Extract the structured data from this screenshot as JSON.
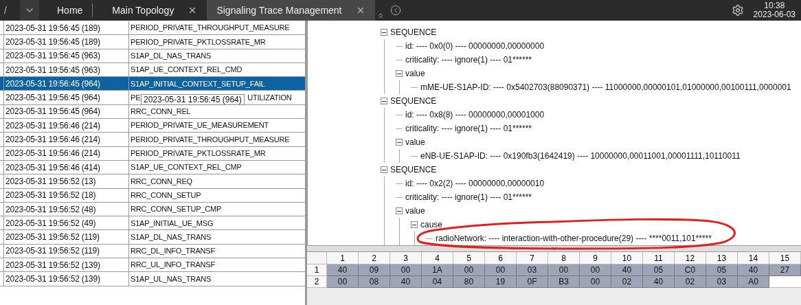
{
  "top_bar": {
    "path": "/",
    "tabs": [
      {
        "label": "Home",
        "selected": false,
        "closable": false
      },
      {
        "label": "Main Topology",
        "selected": false,
        "closable": true
      },
      {
        "label": "Signaling Trace Management",
        "selected": true,
        "closable": true
      }
    ],
    "time": "10:38",
    "date": "2023-06-03"
  },
  "trace_table": {
    "rows": [
      {
        "time": "2023-05-31 19:56:45 (189)",
        "event": "PERIOD_PRIVATE_THROUGHPUT_MEASURE",
        "selected": false
      },
      {
        "time": "2023-05-31 19:56:45 (189)",
        "event": "PERIOD_PRIVATE_PKTLOSSRATE_MR",
        "selected": false
      },
      {
        "time": "2023-05-31 19:56:45 (963)",
        "event": "S1AP_DL_NAS_TRANS",
        "selected": false
      },
      {
        "time": "2023-05-31 19:56:45 (963)",
        "event": "S1AP_UE_CONTEXT_REL_CMD",
        "selected": false
      },
      {
        "time": "2023-05-31 19:56:45 (964)",
        "event": "S1AP_INITIAL_CONTEXT_SETUP_FAIL",
        "selected": true
      },
      {
        "time": "2023-05-31 19:56:45 (964)",
        "event": "PE",
        "event_end": "UTILIZATION",
        "selected": false
      },
      {
        "time": "2023-05-31 19:56:45 (964)",
        "event": "RRC_CONN_REL",
        "selected": false
      },
      {
        "time": "2023-05-31 19:56:46 (214)",
        "event": "PERIOD_PRIVATE_UE_MEASUREMENT",
        "selected": false
      },
      {
        "time": "2023-05-31 19:56:46 (214)",
        "event": "PERIOD_PRIVATE_THROUGHPUT_MEASURE",
        "selected": false
      },
      {
        "time": "2023-05-31 19:56:46 (214)",
        "event": "PERIOD_PRIVATE_PKTLOSSRATE_MR",
        "selected": false
      },
      {
        "time": "2023-05-31 19:56:46 (414)",
        "event": "S1AP_UE_CONTEXT_REL_CMP",
        "selected": false
      },
      {
        "time": "2023-05-31 19:56:52 (13)",
        "event": "RRC_CONN_REQ",
        "selected": false
      },
      {
        "time": "2023-05-31 19:56:52 (18)",
        "event": "RRC_CONN_SETUP",
        "selected": false
      },
      {
        "time": "2023-05-31 19:56:52 (48)",
        "event": "RRC_CONN_SETUP_CMP",
        "selected": false
      },
      {
        "time": "2023-05-31 19:56:52 (49)",
        "event": "S1AP_INITIAL_UE_MSG",
        "selected": false
      },
      {
        "time": "2023-05-31 19:56:52 (119)",
        "event": "S1AP_DL_NAS_TRANS",
        "selected": false
      },
      {
        "time": "2023-05-31 19:56:52 (119)",
        "event": "RRC_DL_INFO_TRANSF",
        "selected": false
      },
      {
        "time": "2023-05-31 19:56:52 (139)",
        "event": "RRC_UL_INFO_TRANSF",
        "selected": false
      },
      {
        "time": "2023-05-31 19:56:52 (139)",
        "event": "S1AP_UL_NAS_TRANS",
        "selected": false
      }
    ],
    "tooltip": "2023-05-31 19:56:45 (964)"
  },
  "decode_tree": [
    {
      "label": "SEQUENCE",
      "expanded": true,
      "children": [
        {
          "label": "id: ---- 0x0(0) ---- 00000000,00000000"
        },
        {
          "label": "criticality: ---- ignore(1) ---- 01******"
        },
        {
          "label": "value",
          "expanded": true,
          "children": [
            {
              "label": "mME-UE-S1AP-ID: ---- 0x5402703(88090371) ---- 11000000,00000101,01000000,00100111,0000001"
            }
          ]
        }
      ]
    },
    {
      "label": "SEQUENCE",
      "expanded": true,
      "children": [
        {
          "label": "id: ---- 0x8(8) ---- 00000000,00001000"
        },
        {
          "label": "criticality: ---- ignore(1) ---- 01******"
        },
        {
          "label": "value",
          "expanded": true,
          "children": [
            {
              "label": "eNB-UE-S1AP-ID: ---- 0x190fb3(1642419) ---- 10000000,00011001,00001111,10110011"
            }
          ]
        }
      ]
    },
    {
      "label": "SEQUENCE",
      "expanded": true,
      "children": [
        {
          "label": "id: ---- 0x2(2) ---- 00000000,00000010"
        },
        {
          "label": "criticality: ---- ignore(1) ---- 01******"
        },
        {
          "label": "value",
          "expanded": true,
          "children": [
            {
              "label": "cause",
              "expanded": true,
              "children": [
                {
                  "label": "radioNetwork: ---- interaction-with-other-procedure(29) ---- ****0011,101*****"
                }
              ]
            }
          ]
        }
      ]
    }
  ],
  "hex_grid": {
    "columns": [
      "1",
      "2",
      "3",
      "4",
      "5",
      "6",
      "7",
      "8",
      "9",
      "10",
      "11",
      "12",
      "13",
      "14",
      "15"
    ],
    "rows": [
      {
        "label": "1",
        "bytes": [
          "40",
          "09",
          "00",
          "1A",
          "00",
          "00",
          "03",
          "00",
          "00",
          "40",
          "05",
          "C0",
          "05",
          "40",
          "27"
        ]
      },
      {
        "label": "2",
        "bytes": [
          "00",
          "08",
          "40",
          "04",
          "80",
          "19",
          "0F",
          "B3",
          "00",
          "02",
          "40",
          "02",
          "03",
          "A0"
        ]
      }
    ]
  }
}
